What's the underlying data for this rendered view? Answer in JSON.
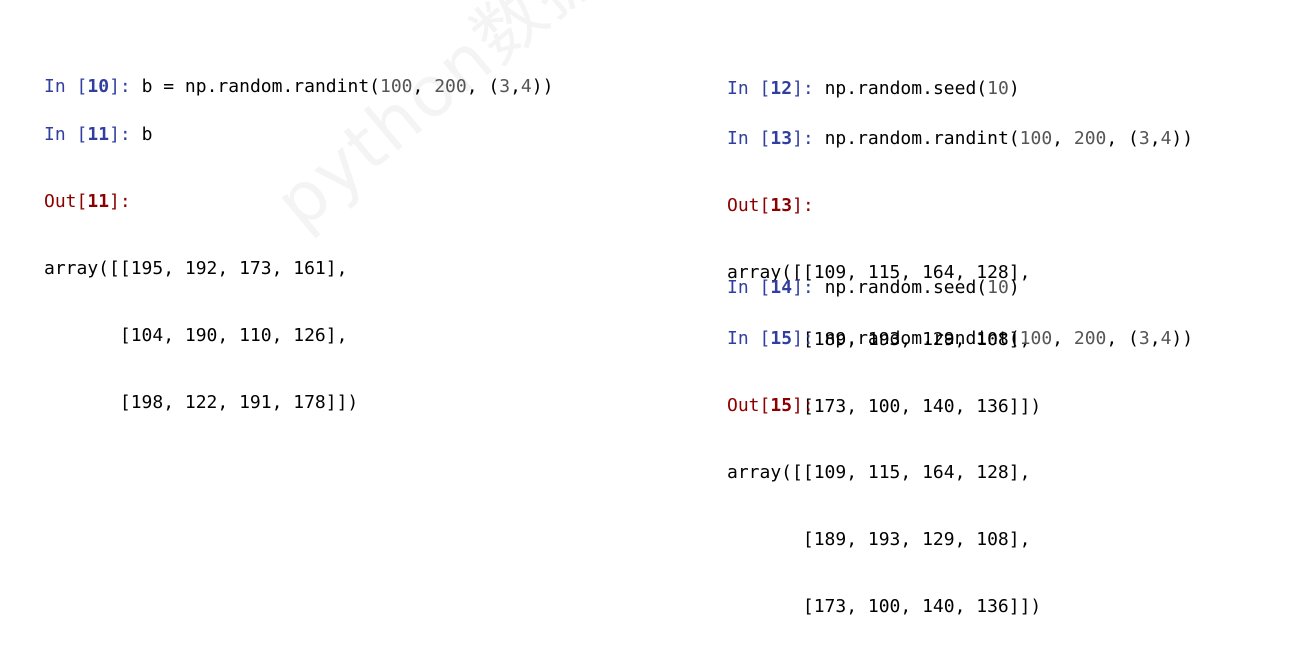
{
  "watermark": "python数据分析与挖掘",
  "colors": {
    "in_prompt": "#303f9f",
    "out_prompt": "#8b0000",
    "number_literal": "#555555",
    "text": "#000000"
  },
  "left_cells": [
    {
      "in_label": "In",
      "in_num": "10",
      "code": "b = np.random.randint(100, 200, (3,4))",
      "output": []
    },
    {
      "in_label": "In",
      "in_num": "11",
      "code": "b",
      "out_label": "Out",
      "out_num": "11",
      "output": [
        "array([[195, 192, 173, 161],",
        "       [104, 190, 110, 126],",
        "       [198, 122, 191, 178]])"
      ]
    }
  ],
  "right_cells": [
    {
      "in_label": "In",
      "in_num": "12",
      "code": "np.random.seed(10)",
      "output": []
    },
    {
      "in_label": "In",
      "in_num": "13",
      "code": "np.random.randint(100, 200, (3,4))",
      "out_label": "Out",
      "out_num": "13",
      "output": [
        "array([[109, 115, 164, 128],",
        "       [189, 193, 129, 108],",
        "       [173, 100, 140, 136]])"
      ]
    },
    {
      "in_label": "In",
      "in_num": "14",
      "code": "np.random.seed(10)",
      "output": []
    },
    {
      "in_label": "In",
      "in_num": "15",
      "code": "np.random.randint(100, 200, (3,4))",
      "out_label": "Out",
      "out_num": "15",
      "output": [
        "array([[109, 115, 164, 128],",
        "       [189, 193, 129, 108],",
        "       [173, 100, 140, 136]])"
      ]
    }
  ]
}
